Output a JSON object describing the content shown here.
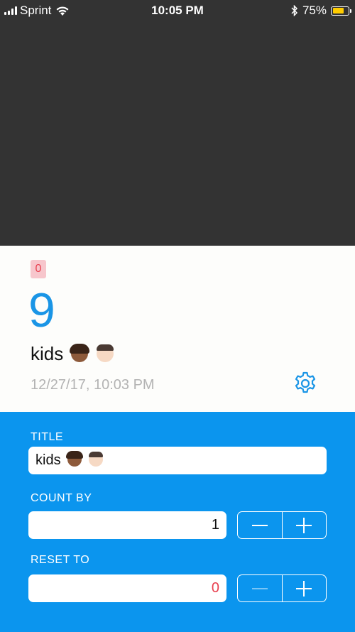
{
  "status_bar": {
    "carrier": "Sprint",
    "time": "10:05 PM",
    "battery_percent": "75%",
    "battery_level": 0.75,
    "battery_color": "#ffcc00"
  },
  "counter": {
    "badge_value": "0",
    "count": "9",
    "title": "kids",
    "title_emojis": [
      "woman-medium-dark-skin",
      "man-light-skin"
    ],
    "timestamp": "12/27/17, 10:03 PM"
  },
  "settings": {
    "title_label": "TITLE",
    "title_value": "kids",
    "count_by_label": "COUNT BY",
    "count_by_value": "1",
    "reset_to_label": "RESET TO",
    "reset_to_value": "0"
  },
  "colors": {
    "accent": "#1a95e6",
    "settings_bg": "#0b95ee",
    "badge_bg": "#f7c6cc",
    "badge_text": "#e8404f"
  },
  "icons": {
    "settings": "gear-icon",
    "decrement": "minus-icon",
    "increment": "plus-icon"
  }
}
